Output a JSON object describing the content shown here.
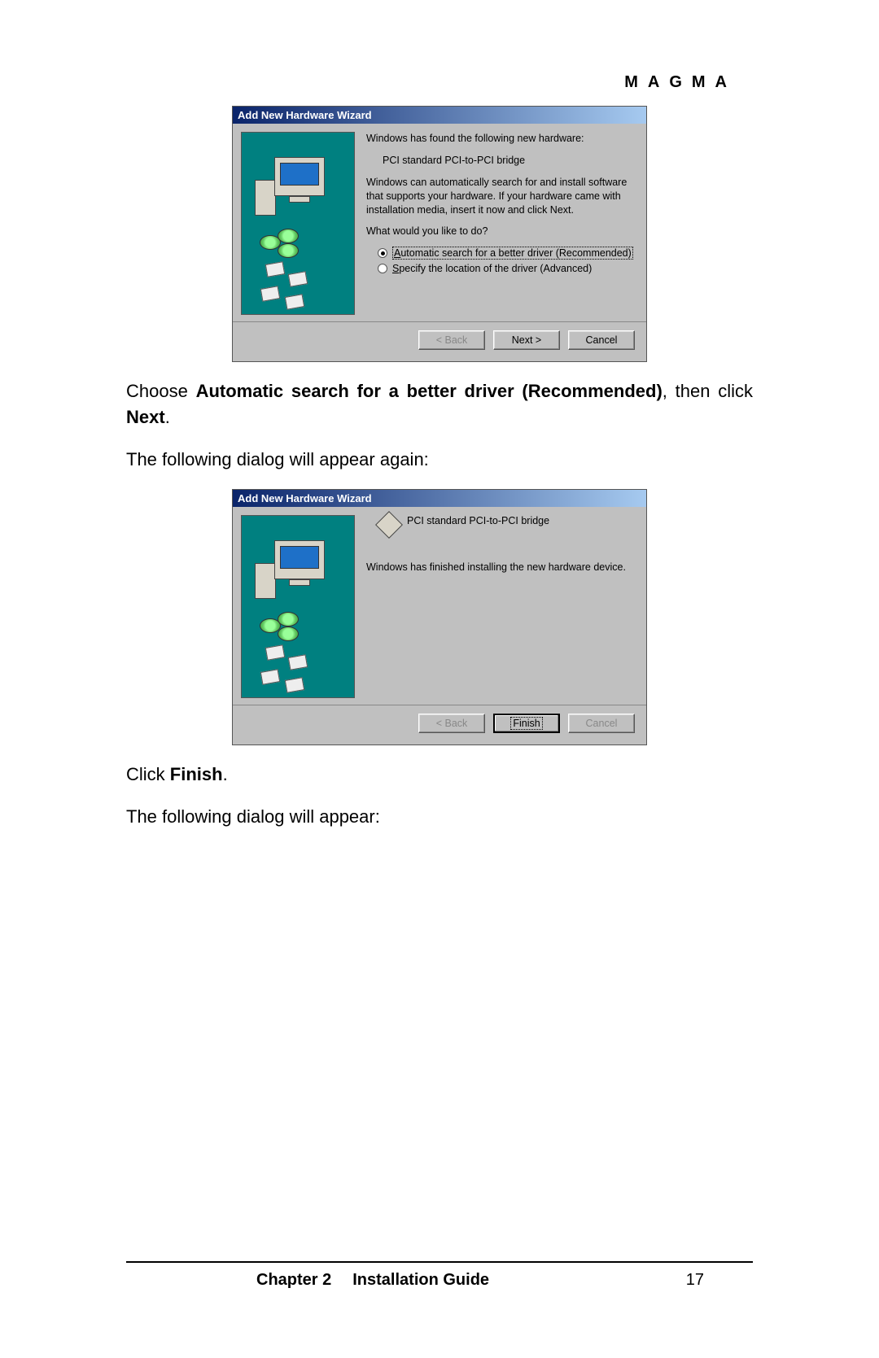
{
  "header": {
    "brand": "MAGMA"
  },
  "dialog1": {
    "title": "Add New Hardware Wizard",
    "found_line": "Windows has found the following new hardware:",
    "device": "PCI standard PCI-to-PCI bridge",
    "auto_text": "Windows can automatically search for and install software that supports your hardware. If your hardware came with installation media, insert it now and click Next.",
    "prompt": "What would you like to do?",
    "option1_pre": "A",
    "option1_rest": "utomatic search for a better driver (Recommended)",
    "option2_pre": "S",
    "option2_rest": "pecify the location of the driver (Advanced)",
    "back": "< Back",
    "next": "Next >",
    "cancel": "Cancel"
  },
  "para1_pre": "Choose ",
  "para1_bold": "Automatic search for a better driver (Recommended)",
  "para1_mid": ", then click ",
  "para1_bold2": "Next",
  "para1_end": ".",
  "para2": "The following dialog will appear again:",
  "dialog2": {
    "title": "Add New Hardware Wizard",
    "device": "PCI standard PCI-to-PCI bridge",
    "done": "Windows has finished installing the new hardware device.",
    "back": "< Back",
    "finish": "Finish",
    "cancel": "Cancel"
  },
  "para3_pre": "Click ",
  "para3_bold": "Finish",
  "para3_end": ".",
  "para4": "The following dialog will appear:",
  "footer": {
    "chapter": "Chapter 2",
    "guide": "Installation Guide",
    "page": "17"
  }
}
